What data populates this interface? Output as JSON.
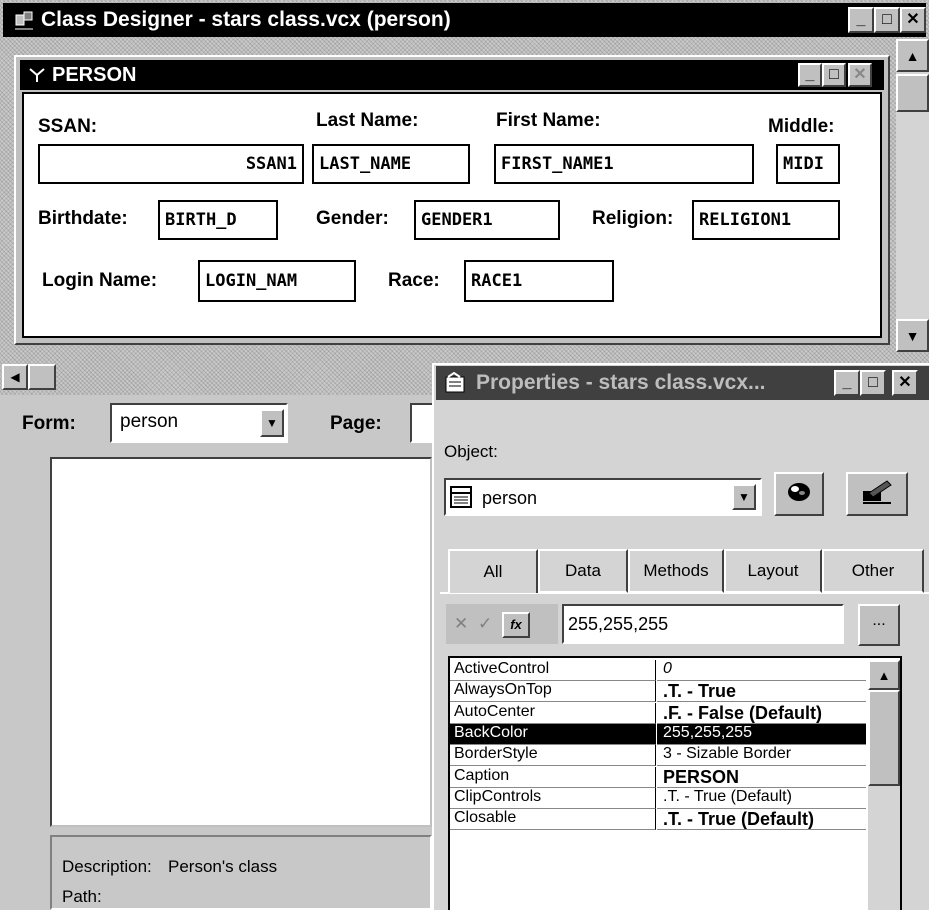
{
  "main_window": {
    "title": "Class Designer - stars class.vcx (person)"
  },
  "form_window": {
    "title": "PERSON",
    "labels": {
      "ssan": "SSAN:",
      "last_name": "Last Name:",
      "first_name": "First Name:",
      "middle": "Middle:",
      "birthdate": "Birthdate:",
      "gender": "Gender:",
      "religion": "Religion:",
      "login_name": "Login Name:",
      "race": "Race:"
    },
    "fields": {
      "ssan": "SSAN1",
      "last_name": "LAST_NAME",
      "first_name": "FIRST_NAME1",
      "middle": "MIDI",
      "birthdate": "BIRTH_D",
      "gender": "GENDER1",
      "religion": "RELIGION1",
      "login_name": "LOGIN_NAM",
      "race": "RACE1"
    }
  },
  "lower_panel": {
    "form_label": "Form:",
    "form_value": "person",
    "page_label": "Page:",
    "description_label": "Description:",
    "description_value": "Person's class",
    "path_label": "Path:"
  },
  "properties_window": {
    "title": "Properties - stars class.vcx...",
    "object_label": "Object:",
    "object_value": "person",
    "tabs": [
      "All",
      "Data",
      "Methods",
      "Layout",
      "Other"
    ],
    "active_tab": "All",
    "edit_value": "255,255,255",
    "edit_buttons": {
      "cancel": "✕",
      "accept": "✓",
      "function": "fx",
      "more": "..."
    },
    "properties": [
      {
        "name": "ActiveControl",
        "value": "0",
        "style": "italic"
      },
      {
        "name": "AlwaysOnTop",
        "value": ".T. - True",
        "style": "bold"
      },
      {
        "name": "AutoCenter",
        "value": ".F. - False (Default)",
        "style": "bold"
      },
      {
        "name": "BackColor",
        "value": "255,255,255",
        "style": "selected"
      },
      {
        "name": "BorderStyle",
        "value": "3 - Sizable Border",
        "style": "normal"
      },
      {
        "name": "Caption",
        "value": "PERSON",
        "style": "bold"
      },
      {
        "name": "ClipControls",
        "value": ".T. - True (Default)",
        "style": "normal"
      },
      {
        "name": "Closable",
        "value": ".T. - True (Default)",
        "style": "bold"
      }
    ]
  },
  "icons": [
    "class-designer-icon",
    "form-icon",
    "properties-icon",
    "grid-icon",
    "color-ball-icon",
    "builder-icon",
    "dropdown-arrow-icon"
  ],
  "colors": {
    "titlebar": "#000000",
    "selected_row": "#000000",
    "face": "#c0c0c0"
  }
}
